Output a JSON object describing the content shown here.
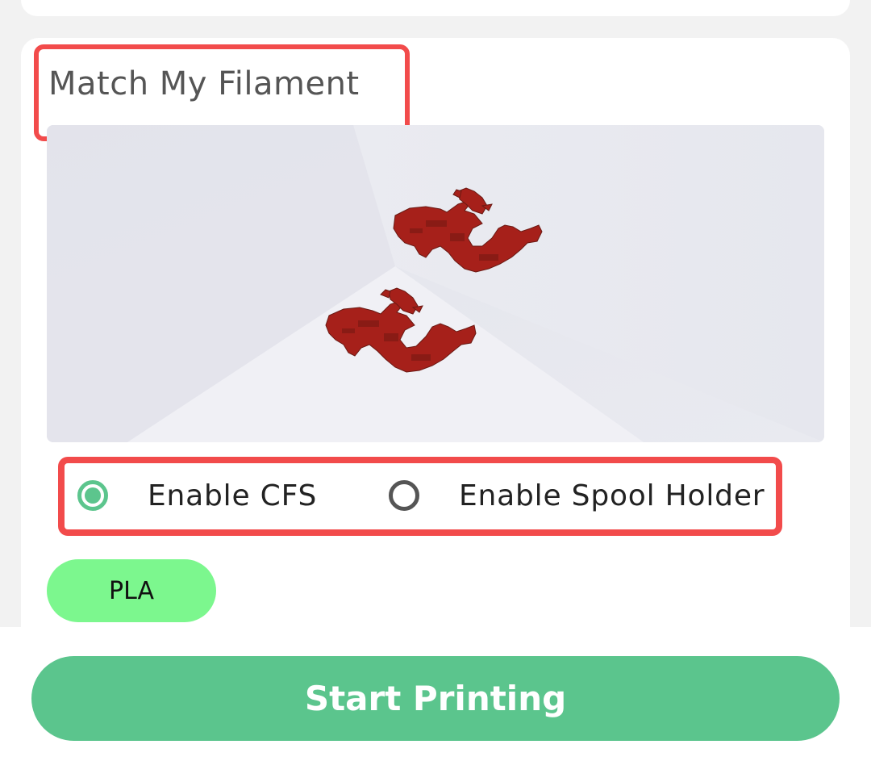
{
  "section": {
    "title": "Match My Filament"
  },
  "preview": {
    "model_color": "#a6201a",
    "model_count": 2
  },
  "options": {
    "cfs_label": "Enable CFS",
    "cfs_selected": true,
    "spool_label": "Enable Spool Holder",
    "spool_selected": false
  },
  "filament": {
    "chip_label": "PLA",
    "chip_color": "#7cf78e"
  },
  "actions": {
    "start_label": "Start Printing",
    "start_color": "#5bc58d"
  },
  "highlight_color": "#f24b4b"
}
